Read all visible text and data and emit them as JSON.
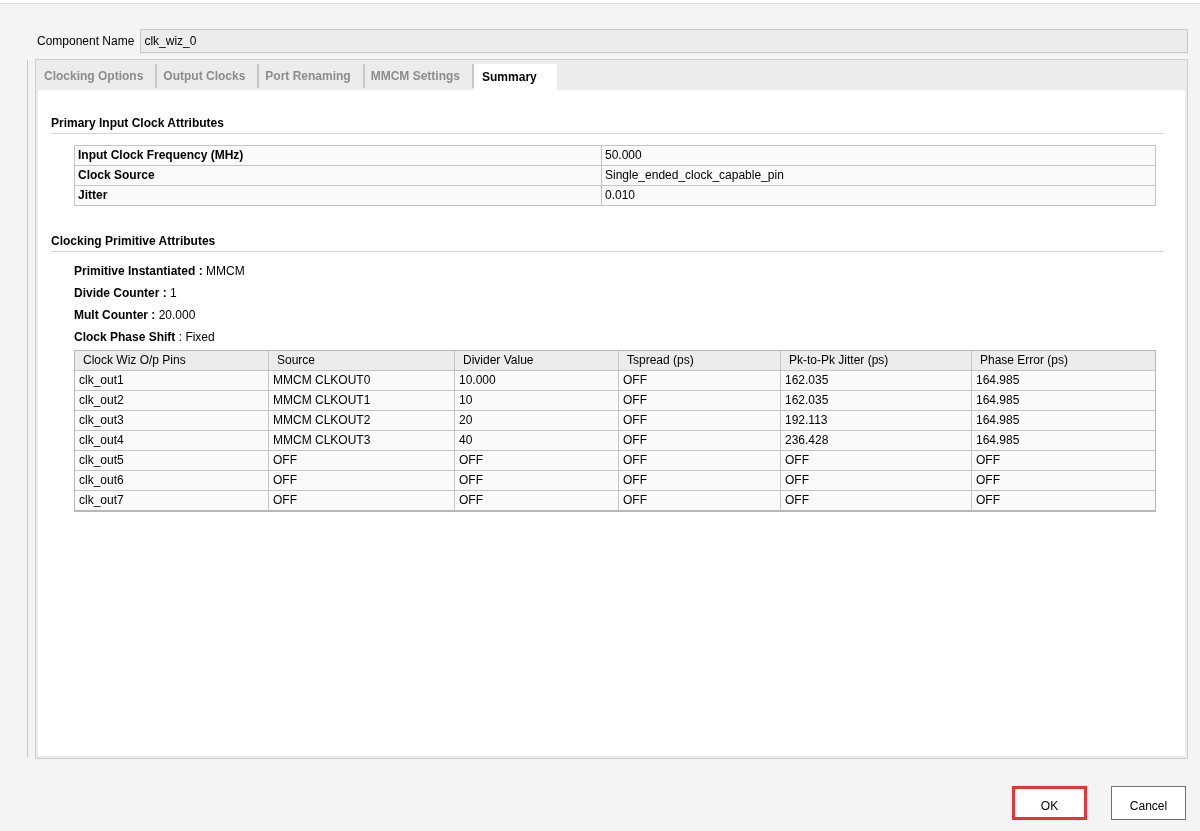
{
  "component_name": {
    "label": "Component Name",
    "value": "clk_wiz_0"
  },
  "tabs": [
    {
      "label": "Clocking Options",
      "selected": false
    },
    {
      "label": "Output Clocks",
      "selected": false
    },
    {
      "label": "Port Renaming",
      "selected": false
    },
    {
      "label": "MMCM Settings",
      "selected": false
    },
    {
      "label": "Summary",
      "selected": true
    }
  ],
  "primary_input": {
    "heading": "Primary Input Clock Attributes",
    "rows": [
      {
        "name": "Input Clock Frequency (MHz)",
        "value": "50.000"
      },
      {
        "name": "Clock Source",
        "value": "Single_ended_clock_capable_pin"
      },
      {
        "name": "Jitter",
        "value": "0.010"
      }
    ]
  },
  "primitive": {
    "heading": "Clocking Primitive Attributes",
    "attributes": [
      {
        "name": "Primitive Instantiated :",
        "value": "MMCM"
      },
      {
        "name": "Divide Counter :",
        "value": "1"
      },
      {
        "name": "Mult Counter :",
        "value": "20.000"
      },
      {
        "name": "Clock Phase Shift",
        "value": ": Fixed"
      }
    ],
    "table": {
      "columns": [
        "Clock Wiz O/p Pins",
        "Source",
        "Divider Value",
        "Tspread (ps)",
        "Pk-to-Pk Jitter (ps)",
        "Phase Error (ps)"
      ],
      "rows": [
        [
          "clk_out1",
          "MMCM CLKOUT0",
          "10.000",
          "OFF",
          "162.035",
          "164.985"
        ],
        [
          "clk_out2",
          "MMCM CLKOUT1",
          "10",
          "OFF",
          "162.035",
          "164.985"
        ],
        [
          "clk_out3",
          "MMCM CLKOUT2",
          "20",
          "OFF",
          "192.113",
          "164.985"
        ],
        [
          "clk_out4",
          "MMCM CLKOUT3",
          "40",
          "OFF",
          "236.428",
          "164.985"
        ],
        [
          "clk_out5",
          "OFF",
          "OFF",
          "OFF",
          "OFF",
          "OFF"
        ],
        [
          "clk_out6",
          "OFF",
          "OFF",
          "OFF",
          "OFF",
          "OFF"
        ],
        [
          "clk_out7",
          "OFF",
          "OFF",
          "OFF",
          "OFF",
          "OFF"
        ]
      ]
    }
  },
  "buttons": [
    {
      "label": "OK",
      "highlighted": true
    },
    {
      "label": "Cancel",
      "highlighted": false
    }
  ]
}
